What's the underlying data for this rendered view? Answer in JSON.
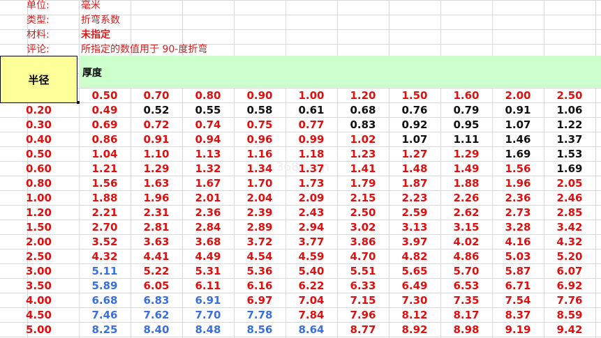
{
  "meta": [
    {
      "key": "单位:",
      "value": "毫米",
      "bold": false
    },
    {
      "key": "类型:",
      "value": "折弯系数",
      "bold": false
    },
    {
      "key": "材料:",
      "value": "未指定",
      "bold": true
    },
    {
      "key": "评论:",
      "value": "所指定的数值用于 90-度折弯",
      "bold": false
    }
  ],
  "radius_label": "半径",
  "thickness_label": "厚度",
  "watermark": "c...3688...m",
  "thicknesses": [
    "0.50",
    "0.70",
    "0.80",
    "0.90",
    "1.00",
    "1.20",
    "1.50",
    "1.60",
    "2.00",
    "2.50"
  ],
  "rows": [
    {
      "r": "0.20",
      "v": [
        "0.49",
        "0.52",
        "0.55",
        "0.58",
        "0.61",
        "0.68",
        "0.76",
        "0.79",
        "0.91",
        "1.06"
      ],
      "c": [
        "r",
        "k",
        "k",
        "k",
        "k",
        "k",
        "k",
        "k",
        "k",
        "k"
      ]
    },
    {
      "r": "0.30",
      "v": [
        "0.69",
        "0.72",
        "0.74",
        "0.75",
        "0.77",
        "0.83",
        "0.92",
        "0.95",
        "1.07",
        "1.22"
      ],
      "c": [
        "r",
        "r",
        "r",
        "r",
        "r",
        "k",
        "k",
        "k",
        "k",
        "k"
      ]
    },
    {
      "r": "0.40",
      "v": [
        "0.86",
        "0.91",
        "0.94",
        "0.96",
        "0.99",
        "1.02",
        "1.07",
        "1.11",
        "1.46",
        "1.37"
      ],
      "c": [
        "r",
        "r",
        "r",
        "r",
        "r",
        "r",
        "k",
        "k",
        "k",
        "k"
      ]
    },
    {
      "r": "0.50",
      "v": [
        "1.04",
        "1.10",
        "1.13",
        "1.16",
        "1.18",
        "1.23",
        "1.27",
        "1.29",
        "1.69",
        "1.53"
      ],
      "c": [
        "r",
        "r",
        "r",
        "r",
        "r",
        "r",
        "r",
        "r",
        "k",
        "k"
      ]
    },
    {
      "r": "0.60",
      "v": [
        "1.21",
        "1.29",
        "1.32",
        "1.34",
        "1.37",
        "1.41",
        "1.48",
        "1.49",
        "1.56",
        "1.69"
      ],
      "c": [
        "r",
        "r",
        "r",
        "r",
        "r",
        "r",
        "r",
        "r",
        "r",
        "k"
      ]
    },
    {
      "r": "0.80",
      "v": [
        "1.56",
        "1.63",
        "1.67",
        "1.70",
        "1.73",
        "1.79",
        "1.87",
        "1.88",
        "1.96",
        "2.05"
      ],
      "c": [
        "r",
        "r",
        "r",
        "r",
        "r",
        "r",
        "r",
        "r",
        "r",
        "r"
      ]
    },
    {
      "r": "1.00",
      "v": [
        "1.88",
        "1.96",
        "2.01",
        "2.04",
        "2.09",
        "2.15",
        "2.23",
        "2.26",
        "2.36",
        "2.46"
      ],
      "c": [
        "r",
        "r",
        "r",
        "r",
        "r",
        "r",
        "r",
        "r",
        "r",
        "r"
      ]
    },
    {
      "r": "1.20",
      "v": [
        "2.21",
        "2.31",
        "2.36",
        "2.39",
        "2.43",
        "2.50",
        "2.59",
        "2.62",
        "2.73",
        "2.85"
      ],
      "c": [
        "r",
        "r",
        "r",
        "r",
        "r",
        "r",
        "r",
        "r",
        "r",
        "r"
      ]
    },
    {
      "r": "1.50",
      "v": [
        "2.70",
        "2.81",
        "2.84",
        "2.89",
        "2.94",
        "3.02",
        "3.13",
        "3.15",
        "3.28",
        "3.42"
      ],
      "c": [
        "r",
        "r",
        "r",
        "r",
        "r",
        "r",
        "r",
        "r",
        "r",
        "r"
      ]
    },
    {
      "r": "2.00",
      "v": [
        "3.52",
        "3.63",
        "3.68",
        "3.72",
        "3.77",
        "3.86",
        "3.97",
        "4.02",
        "4.16",
        "4.32"
      ],
      "c": [
        "r",
        "r",
        "r",
        "r",
        "r",
        "r",
        "r",
        "r",
        "r",
        "r"
      ]
    },
    {
      "r": "2.50",
      "v": [
        "4.32",
        "4.41",
        "4.49",
        "4.54",
        "4.59",
        "4.70",
        "4.82",
        "4.86",
        "5.03",
        "5.20"
      ],
      "c": [
        "r",
        "r",
        "r",
        "r",
        "r",
        "r",
        "r",
        "r",
        "r",
        "r"
      ]
    },
    {
      "r": "3.00",
      "v": [
        "5.11",
        "5.22",
        "5.31",
        "5.36",
        "5.40",
        "5.51",
        "5.65",
        "5.70",
        "5.87",
        "6.07"
      ],
      "c": [
        "b",
        "r",
        "r",
        "r",
        "r",
        "r",
        "r",
        "r",
        "r",
        "r"
      ]
    },
    {
      "r": "3.50",
      "v": [
        "5.89",
        "6.05",
        "6.11",
        "6.16",
        "6.22",
        "6.33",
        "6.49",
        "6.53",
        "6.71",
        "6.92"
      ],
      "c": [
        "b",
        "r",
        "r",
        "r",
        "r",
        "r",
        "r",
        "r",
        "r",
        "r"
      ]
    },
    {
      "r": "4.00",
      "v": [
        "6.68",
        "6.83",
        "6.91",
        "6.97",
        "7.04",
        "7.15",
        "7.30",
        "7.35",
        "7.54",
        "7.76"
      ],
      "c": [
        "b",
        "b",
        "b",
        "r",
        "r",
        "r",
        "r",
        "r",
        "r",
        "r"
      ]
    },
    {
      "r": "4.50",
      "v": [
        "7.46",
        "7.62",
        "7.70",
        "7.78",
        "7.84",
        "7.96",
        "8.12",
        "8.17",
        "8.37",
        "8.59"
      ],
      "c": [
        "b",
        "b",
        "b",
        "b",
        "r",
        "r",
        "r",
        "r",
        "r",
        "r"
      ]
    },
    {
      "r": "5.00",
      "v": [
        "8.25",
        "8.40",
        "8.48",
        "8.56",
        "8.64",
        "8.77",
        "8.92",
        "8.98",
        "9.19",
        "9.42"
      ],
      "c": [
        "b",
        "b",
        "b",
        "b",
        "b",
        "r",
        "r",
        "r",
        "r",
        "r"
      ]
    }
  ]
}
